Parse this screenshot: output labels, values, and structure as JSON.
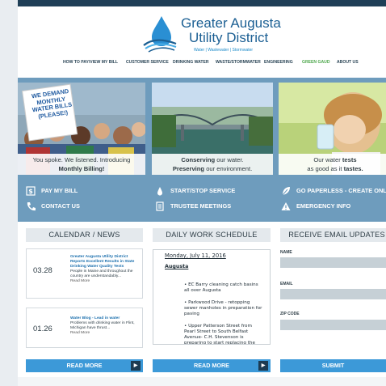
{
  "brand": {
    "name_line1": "Greater Augusta",
    "name_line2": "Utility District",
    "tagline": "Water | Wastewater | Stormwater",
    "accent": "#1b5f93",
    "drop_color": "#2a8fd3"
  },
  "nav": {
    "items": [
      {
        "label": "HOW TO PAY/VIEW MY BILL"
      },
      {
        "label": "CUSTOMER SERVICE"
      },
      {
        "label": "DRINKING WATER"
      },
      {
        "label": "WASTE/STORMWATER"
      },
      {
        "label": "ENGINEERING"
      },
      {
        "label": "GREEN GAUD"
      },
      {
        "label": "ABOUT US"
      }
    ]
  },
  "hero": {
    "panels": [
      {
        "sign": "WE DEMAND MONTHLY WATER BILLS (PLEASE!)",
        "caption_plain": "You spoke. We listened. Introducing",
        "caption_bold": "Monthly Billing!"
      },
      {
        "caption_line1_bold": "Conserving",
        "caption_line1_plain": "our water.",
        "caption_line2_bold": "Preserving",
        "caption_line2_plain": "our environment."
      },
      {
        "caption_line1_plain": "Our water",
        "caption_line1_bold": "tests",
        "caption_line2_plain": "as good as it",
        "caption_line2_bold": "tastes."
      }
    ],
    "links": [
      {
        "label": "PAY MY BILL",
        "icon": "dollar-icon"
      },
      {
        "label": "START/STOP SERVICE",
        "icon": "water-drop-icon"
      },
      {
        "label": "GO PAPERLESS - CREATE ONL",
        "icon": "leaf-icon"
      },
      {
        "label": "CONTACT US",
        "icon": "phone-icon"
      },
      {
        "label": "TRUSTEE MEETINGS",
        "icon": "document-icon"
      },
      {
        "label": "EMERGENCY INFO",
        "icon": "warning-icon"
      }
    ]
  },
  "calendar": {
    "heading": "CALENDAR / NEWS",
    "items": [
      {
        "date": "03.28",
        "title": "Greater Augusta Utility District Reports Excellent Results in State Drinking Water Quality Tests",
        "summary": "People in Maine and throughout the country are understandably...",
        "more": "Read More"
      },
      {
        "date": "01.26",
        "title": "Water Blog - Lead in water",
        "summary": "Problems with drinking water in Flint, Michigan have thrust...",
        "more": "Read More"
      }
    ],
    "button": "READ MORE"
  },
  "schedule": {
    "heading": "DAILY WORK SCHEDULE",
    "date": "Monday, July 11, 2016",
    "town": "Augusta",
    "items": [
      "• EC Barry cleaning catch basins all over Augusta",
      "• Parkwood Drive - retopping sewer manholes in preparation for paving",
      "• Upper Patterson Street from Pearl Street to South Belfast Avenue- C.H. Stevenson is preparing to start replacing the"
    ],
    "button": "READ MORE"
  },
  "email": {
    "heading": "RECEIVE EMAIL UPDATES",
    "fields": [
      {
        "label": "NAME"
      },
      {
        "label": "EMAIL"
      },
      {
        "label": "ZIP CODE"
      }
    ],
    "button": "SUBMIT"
  },
  "colors": {
    "hero_bg": "#6e9cbd",
    "button": "#3c99d8",
    "topbar": "#1f3f57",
    "green_nav": "#4ca64a"
  }
}
